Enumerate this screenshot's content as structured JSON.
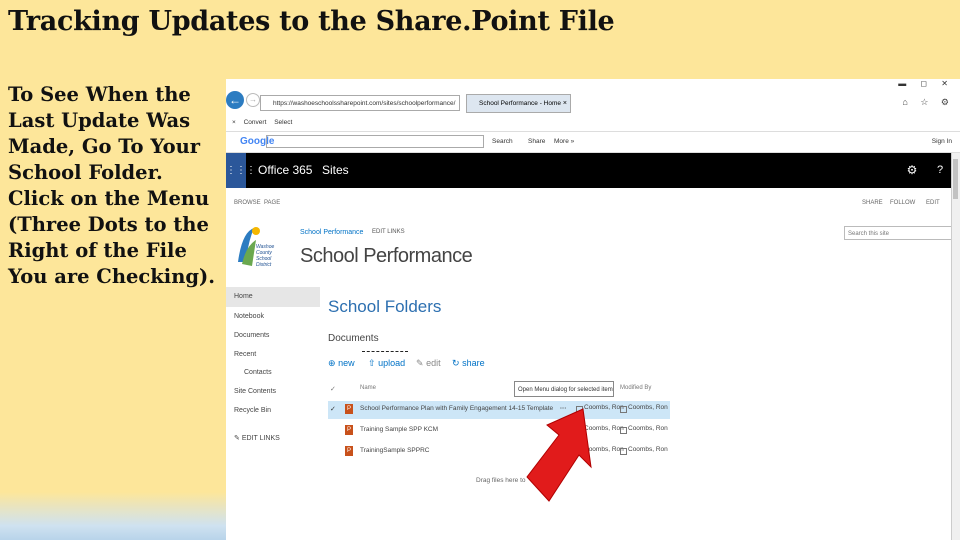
{
  "slide": {
    "title": "Tracking Updates to the Share.Point File",
    "instructions": "To See When the Last Update Was Made, Go To Your School Folder. Click on the Menu (Three Dots to the Right of the File You are Checking)."
  },
  "browser": {
    "address_text": "https://washoeschoolssharepoint.com/sites/schoolperformance/",
    "tab_title": "School Performance - Home",
    "tab_close": "×",
    "window_controls": "▬ ◻ ✕",
    "window_icons": "⌂ ☆ ⚙",
    "back_icon": "back-arrow-icon",
    "forward_icon": "forward-arrow-icon",
    "command_bar": {
      "convert": "Convert",
      "select": "Select"
    },
    "google_bar": {
      "logo": "Google",
      "search": "Search",
      "share": "Share",
      "more": "More »",
      "signin": "Sign In"
    }
  },
  "office365": {
    "brand": "Office 365",
    "sites": "Sites",
    "waffle_glyph": "⋮⋮⋮",
    "gear_glyph": "⚙",
    "help_glyph": "?"
  },
  "ribbon": {
    "browse": "BROWSE",
    "page": "PAGE",
    "share": "SHARE",
    "follow": "FOLLOW",
    "edit": "EDIT"
  },
  "site": {
    "logo_text": "Washoe County School District",
    "breadcrumb": "School Performance",
    "edit_links": "EDIT LINKS",
    "title": "School Performance",
    "search_placeholder": "Search this site"
  },
  "quicklaunch": {
    "items": [
      "Home",
      "Notebook",
      "Documents",
      "Recent",
      "Contacts",
      "Site Contents",
      "Recycle Bin"
    ],
    "edit_links": "EDIT LINKS"
  },
  "library": {
    "page_title": "School Folders",
    "list_title": "Documents",
    "toolbar": {
      "new": "new",
      "upload": "upload",
      "edit": "edit",
      "share": "share"
    },
    "columns": {
      "name": "Name",
      "modified_by": "Modified By"
    },
    "tooltip": "Open Menu dialog for selected item",
    "rows": [
      {
        "name": "School Performance Plan with Family Engagement 14-15 Template",
        "modified": "Coombs, Ron",
        "modified_by": "Coombs, Ron",
        "ellipsis": "···"
      },
      {
        "name": "Training Sample SPP KCM",
        "modified": "Coombs, Ron",
        "modified_by": "Coombs, Ron",
        "ellipsis": ""
      },
      {
        "name": "TrainingSample SPPRC",
        "modified": "Coombs, Ron",
        "modified_by": "Coombs, Ron",
        "ellipsis": ""
      }
    ],
    "drop_hint": "Drag files here to"
  },
  "colors": {
    "slide_background": "#fde69a",
    "office365_bar": "#000000",
    "waffle_blue": "#2b579a",
    "link_blue": "#0072c6",
    "selected_row": "#cde6f7",
    "arrow_red": "#e11b1b"
  }
}
